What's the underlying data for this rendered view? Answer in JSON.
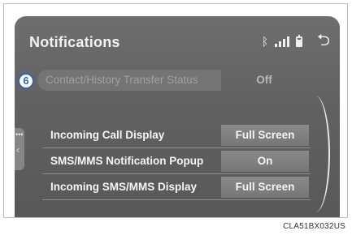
{
  "screen": {
    "title": "Notifications",
    "status_icons": [
      "bluetooth-icon",
      "signal-icon",
      "battery-icon"
    ],
    "back_icon": "back-arrow-icon",
    "callout_number": "6"
  },
  "rows": [
    {
      "label": "Contact/History Transfer Status",
      "value": "Off"
    },
    {
      "label": "Incoming Call Display",
      "value": "Full Screen"
    },
    {
      "label": "SMS/MMS Notification Popup",
      "value": "On"
    },
    {
      "label": "Incoming SMS/MMS Display",
      "value": "Full Screen"
    }
  ],
  "side_tab": {
    "dots": "•••",
    "chevron": "‹"
  },
  "caption": "CLA51BX032US"
}
